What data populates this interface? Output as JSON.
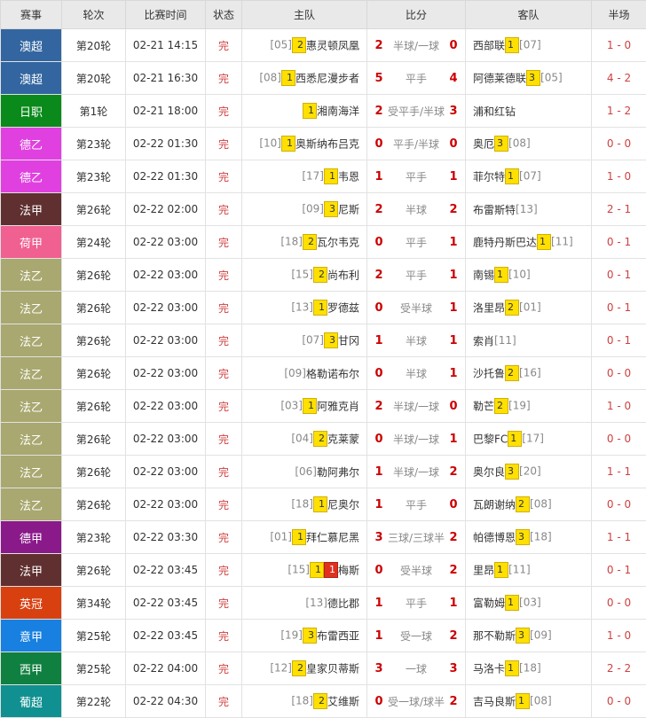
{
  "headers": [
    "赛事",
    "轮次",
    "比赛时间",
    "状态",
    "主队",
    "比分",
    "客队",
    "半场"
  ],
  "matches": [
    {
      "league": "澳超",
      "color": "#3366a0",
      "round": "第20轮",
      "time": "02-21 14:15",
      "status": "完",
      "home_rank": "[05]",
      "home_cards": [
        {
          "n": "2",
          "c": "y"
        }
      ],
      "home": "惠灵顿凤凰",
      "hs": "2",
      "hc": "半球/一球",
      "as": "0",
      "away": "西部联",
      "away_cards": [
        {
          "n": "1",
          "c": "y"
        }
      ],
      "away_rank": "[07]",
      "half": "1 - 0"
    },
    {
      "league": "澳超",
      "color": "#3366a0",
      "round": "第20轮",
      "time": "02-21 16:30",
      "status": "完",
      "home_rank": "[08]",
      "home_cards": [
        {
          "n": "1",
          "c": "y"
        }
      ],
      "home": "西悉尼漫步者",
      "hs": "5",
      "hc": "平手",
      "as": "4",
      "away": "阿德莱德联",
      "away_cards": [
        {
          "n": "3",
          "c": "y"
        }
      ],
      "away_rank": "[05]",
      "half": "4 - 2"
    },
    {
      "league": "日职",
      "color": "#0a8a1a",
      "round": "第1轮",
      "time": "02-21 18:00",
      "status": "完",
      "home_rank": "",
      "home_cards": [
        {
          "n": "1",
          "c": "y"
        }
      ],
      "home": "湘南海洋",
      "hs": "2",
      "hc": "受平手/半球",
      "as": "3",
      "away": "浦和红钻",
      "away_cards": [],
      "away_rank": "",
      "half": "1 - 2"
    },
    {
      "league": "德乙",
      "color": "#e040e0",
      "round": "第23轮",
      "time": "02-22 01:30",
      "status": "完",
      "home_rank": "[10]",
      "home_cards": [
        {
          "n": "1",
          "c": "y"
        }
      ],
      "home": "奥斯纳布吕克",
      "hs": "0",
      "hc": "平手/半球",
      "as": "0",
      "away": "奥厄",
      "away_cards": [
        {
          "n": "3",
          "c": "y"
        }
      ],
      "away_rank": "[08]",
      "half": "0 - 0"
    },
    {
      "league": "德乙",
      "color": "#e040e0",
      "round": "第23轮",
      "time": "02-22 01:30",
      "status": "完",
      "home_rank": "[17]",
      "home_cards": [
        {
          "n": "1",
          "c": "y"
        }
      ],
      "home": "韦恩",
      "hs": "1",
      "hc": "平手",
      "as": "1",
      "away": "菲尔特",
      "away_cards": [
        {
          "n": "1",
          "c": "y"
        }
      ],
      "away_rank": "[07]",
      "half": "1 - 0"
    },
    {
      "league": "法甲",
      "color": "#603030",
      "round": "第26轮",
      "time": "02-22 02:00",
      "status": "完",
      "home_rank": "[09]",
      "home_cards": [
        {
          "n": "3",
          "c": "y"
        }
      ],
      "home": "尼斯",
      "hs": "2",
      "hc": "半球",
      "as": "2",
      "away": "布雷斯特",
      "away_cards": [],
      "away_rank": "[13]",
      "half": "2 - 1"
    },
    {
      "league": "荷甲",
      "color": "#f06090",
      "round": "第24轮",
      "time": "02-22 03:00",
      "status": "完",
      "home_rank": "[18]",
      "home_cards": [
        {
          "n": "2",
          "c": "y"
        }
      ],
      "home": "瓦尔韦克",
      "hs": "0",
      "hc": "平手",
      "as": "1",
      "away": "鹿特丹斯巴达",
      "away_cards": [
        {
          "n": "1",
          "c": "y"
        }
      ],
      "away_rank": "[11]",
      "half": "0 - 1"
    },
    {
      "league": "法乙",
      "color": "#a8a870",
      "round": "第26轮",
      "time": "02-22 03:00",
      "status": "完",
      "home_rank": "[15]",
      "home_cards": [
        {
          "n": "2",
          "c": "y"
        }
      ],
      "home": "尚布利",
      "hs": "2",
      "hc": "平手",
      "as": "1",
      "away": "南锡",
      "away_cards": [
        {
          "n": "1",
          "c": "y"
        }
      ],
      "away_rank": "[10]",
      "half": "0 - 1"
    },
    {
      "league": "法乙",
      "color": "#a8a870",
      "round": "第26轮",
      "time": "02-22 03:00",
      "status": "完",
      "home_rank": "[13]",
      "home_cards": [
        {
          "n": "1",
          "c": "y"
        }
      ],
      "home": "罗德兹",
      "hs": "0",
      "hc": "受半球",
      "as": "1",
      "away": "洛里昂",
      "away_cards": [
        {
          "n": "2",
          "c": "y"
        }
      ],
      "away_rank": "[01]",
      "half": "0 - 1"
    },
    {
      "league": "法乙",
      "color": "#a8a870",
      "round": "第26轮",
      "time": "02-22 03:00",
      "status": "完",
      "home_rank": "[07]",
      "home_cards": [
        {
          "n": "3",
          "c": "y"
        }
      ],
      "home": "甘冈",
      "hs": "1",
      "hc": "半球",
      "as": "1",
      "away": "索肖",
      "away_cards": [],
      "away_rank": "[11]",
      "half": "0 - 1"
    },
    {
      "league": "法乙",
      "color": "#a8a870",
      "round": "第26轮",
      "time": "02-22 03:00",
      "status": "完",
      "home_rank": "[09]",
      "home_cards": [],
      "home": "格勒诺布尔",
      "hs": "0",
      "hc": "半球",
      "as": "1",
      "away": "沙托鲁",
      "away_cards": [
        {
          "n": "2",
          "c": "y"
        }
      ],
      "away_rank": "[16]",
      "half": "0 - 0"
    },
    {
      "league": "法乙",
      "color": "#a8a870",
      "round": "第26轮",
      "time": "02-22 03:00",
      "status": "完",
      "home_rank": "[03]",
      "home_cards": [
        {
          "n": "1",
          "c": "y"
        }
      ],
      "home": "阿雅克肖",
      "hs": "2",
      "hc": "半球/一球",
      "as": "0",
      "away": "勒芒",
      "away_cards": [
        {
          "n": "2",
          "c": "y"
        }
      ],
      "away_rank": "[19]",
      "half": "1 - 0"
    },
    {
      "league": "法乙",
      "color": "#a8a870",
      "round": "第26轮",
      "time": "02-22 03:00",
      "status": "完",
      "home_rank": "[04]",
      "home_cards": [
        {
          "n": "2",
          "c": "y"
        }
      ],
      "home": "克莱蒙",
      "hs": "0",
      "hc": "半球/一球",
      "as": "1",
      "away": "巴黎FC",
      "away_cards": [
        {
          "n": "1",
          "c": "y"
        }
      ],
      "away_rank": "[17]",
      "half": "0 - 0"
    },
    {
      "league": "法乙",
      "color": "#a8a870",
      "round": "第26轮",
      "time": "02-22 03:00",
      "status": "完",
      "home_rank": "[06]",
      "home_cards": [],
      "home": "勒阿弗尔",
      "hs": "1",
      "hc": "半球/一球",
      "as": "2",
      "away": "奥尔良",
      "away_cards": [
        {
          "n": "3",
          "c": "y"
        }
      ],
      "away_rank": "[20]",
      "half": "1 - 1"
    },
    {
      "league": "法乙",
      "color": "#a8a870",
      "round": "第26轮",
      "time": "02-22 03:00",
      "status": "完",
      "home_rank": "[18]",
      "home_cards": [
        {
          "n": "1",
          "c": "y"
        }
      ],
      "home": "尼奥尔",
      "hs": "1",
      "hc": "平手",
      "as": "0",
      "away": "瓦朗谢纳",
      "away_cards": [
        {
          "n": "2",
          "c": "y"
        }
      ],
      "away_rank": "[08]",
      "half": "0 - 0"
    },
    {
      "league": "德甲",
      "color": "#8a1a8a",
      "round": "第23轮",
      "time": "02-22 03:30",
      "status": "完",
      "home_rank": "[01]",
      "home_cards": [
        {
          "n": "1",
          "c": "y"
        }
      ],
      "home": "拜仁慕尼黑",
      "hs": "3",
      "hc": "三球/三球半",
      "as": "2",
      "away": "帕德博恩",
      "away_cards": [
        {
          "n": "3",
          "c": "y"
        }
      ],
      "away_rank": "[18]",
      "half": "1 - 1"
    },
    {
      "league": "法甲",
      "color": "#603030",
      "round": "第26轮",
      "time": "02-22 03:45",
      "status": "完",
      "home_rank": "[15]",
      "home_cards": [
        {
          "n": "1",
          "c": "y"
        },
        {
          "n": "1",
          "c": "r"
        }
      ],
      "home": "梅斯",
      "hs": "0",
      "hc": "受半球",
      "as": "2",
      "away": "里昂",
      "away_cards": [
        {
          "n": "1",
          "c": "y"
        }
      ],
      "away_rank": "[11]",
      "half": "0 - 1"
    },
    {
      "league": "英冠",
      "color": "#d84010",
      "round": "第34轮",
      "time": "02-22 03:45",
      "status": "完",
      "home_rank": "[13]",
      "home_cards": [],
      "home": "德比郡",
      "hs": "1",
      "hc": "平手",
      "as": "1",
      "away": "富勒姆",
      "away_cards": [
        {
          "n": "1",
          "c": "y"
        }
      ],
      "away_rank": "[03]",
      "half": "0 - 0"
    },
    {
      "league": "意甲",
      "color": "#1880e0",
      "round": "第25轮",
      "time": "02-22 03:45",
      "status": "完",
      "home_rank": "[19]",
      "home_cards": [
        {
          "n": "3",
          "c": "y"
        }
      ],
      "home": "布雷西亚",
      "hs": "1",
      "hc": "受一球",
      "as": "2",
      "away": "那不勒斯",
      "away_cards": [
        {
          "n": "3",
          "c": "y"
        }
      ],
      "away_rank": "[09]",
      "half": "1 - 0"
    },
    {
      "league": "西甲",
      "color": "#108040",
      "round": "第25轮",
      "time": "02-22 04:00",
      "status": "完",
      "home_rank": "[12]",
      "home_cards": [
        {
          "n": "2",
          "c": "y"
        }
      ],
      "home": "皇家贝蒂斯",
      "hs": "3",
      "hc": "一球",
      "as": "3",
      "away": "马洛卡",
      "away_cards": [
        {
          "n": "1",
          "c": "y"
        }
      ],
      "away_rank": "[18]",
      "half": "2 - 2"
    },
    {
      "league": "葡超",
      "color": "#109090",
      "round": "第22轮",
      "time": "02-22 04:30",
      "status": "完",
      "home_rank": "[18]",
      "home_cards": [
        {
          "n": "2",
          "c": "y"
        }
      ],
      "home": "艾维斯",
      "hs": "0",
      "hc": "受一球/球半",
      "as": "2",
      "away": "吉马良斯",
      "away_cards": [
        {
          "n": "1",
          "c": "y"
        }
      ],
      "away_rank": "[08]",
      "half": "0 - 0"
    }
  ]
}
